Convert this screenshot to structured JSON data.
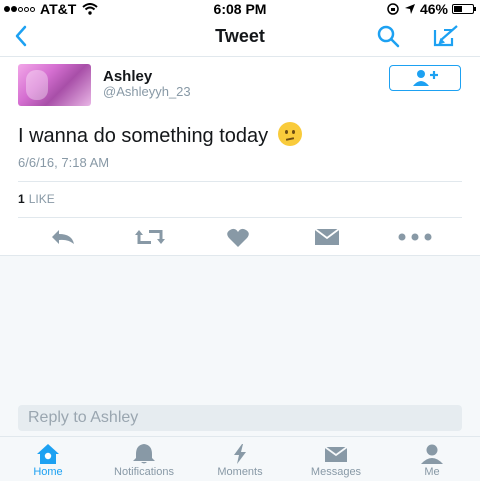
{
  "status_bar": {
    "carrier": "AT&T",
    "time": "6:08 PM",
    "battery": "46%",
    "battery_level": 0.46
  },
  "nav": {
    "title": "Tweet",
    "back_icon": "chevron-left-icon",
    "search_icon": "search-icon",
    "compose_icon": "compose-icon"
  },
  "tweet": {
    "author_name": "Ashley",
    "author_handle": "@Ashleyyh_23",
    "text": "I wanna do something today",
    "emoji": "confused-face-emoji",
    "timestamp": "6/6/16, 7:18 AM",
    "like_count": "1",
    "like_label": "LIKE"
  },
  "actions": [
    "reply-icon",
    "retweet-icon",
    "like-icon",
    "message-icon",
    "more-icon"
  ],
  "reply": {
    "placeholder": "Reply to Ashley"
  },
  "tabs": [
    {
      "label": "Home",
      "icon": "home-icon",
      "active": true
    },
    {
      "label": "Notifications",
      "icon": "bell-icon",
      "active": false
    },
    {
      "label": "Moments",
      "icon": "lightning-icon",
      "active": false
    },
    {
      "label": "Messages",
      "icon": "envelope-icon",
      "active": false
    },
    {
      "label": "Me",
      "icon": "person-icon",
      "active": false
    }
  ],
  "colors": {
    "accent": "#1da1f2",
    "muted": "#8899a6",
    "text": "#14171a",
    "background_gray": "#f5f8fa"
  }
}
